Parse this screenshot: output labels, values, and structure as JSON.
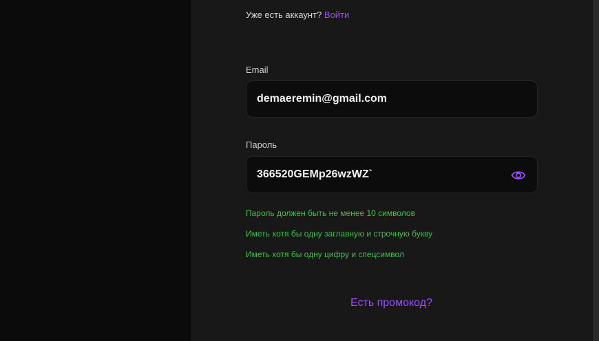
{
  "header": {
    "have_account_text": "Уже есть аккаунт?",
    "login_link": "Войти"
  },
  "email": {
    "label": "Email",
    "value": "demaeremin@gmail.com"
  },
  "password": {
    "label": "Пароль",
    "value": "366520GEMp26wzWZ`",
    "toggle_icon": "eye-icon"
  },
  "password_rules": [
    "Пароль должен быть не менее 10 символов",
    "Иметь хотя бы одну заглавную и строчную букву",
    "Иметь хотя бы одну цифру и спецсимвол"
  ],
  "promo_link": "Есть промокод?",
  "colors": {
    "accent": "#9a4dff",
    "rule_ok": "#3fbf4a",
    "panel": "#181818",
    "background": "#0b0b0b"
  }
}
